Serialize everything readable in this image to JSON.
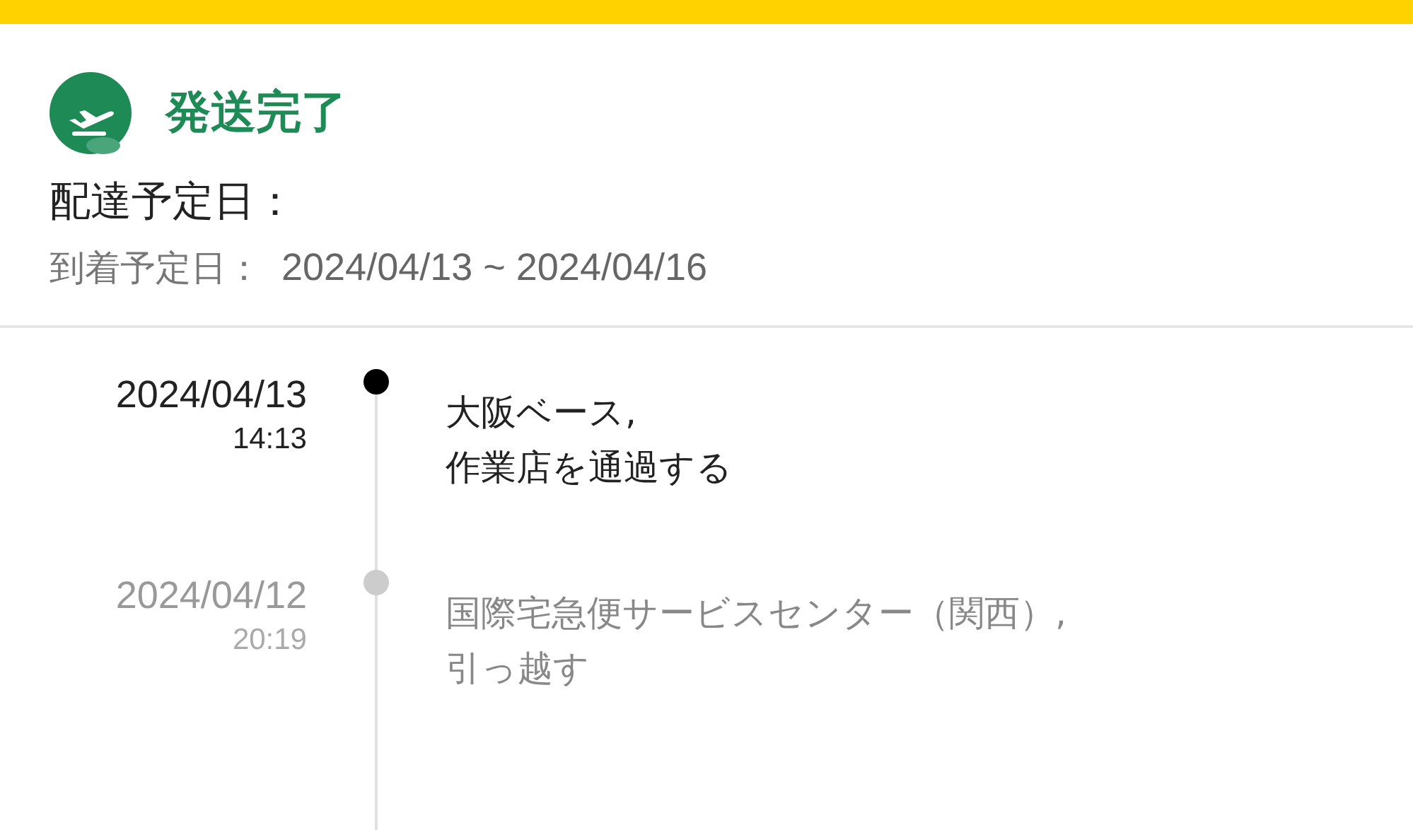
{
  "status": {
    "title": "発送完了"
  },
  "delivery": {
    "label": "配達予定日：",
    "eta_label": "到着予定日：",
    "eta_range": "2024/04/13 ~ 2024/04/16"
  },
  "timeline": [
    {
      "date": "2024/04/13",
      "time": "14:13",
      "place": "大阪ベース,",
      "event": "作業店を通過する",
      "current": true
    },
    {
      "date": "2024/04/12",
      "time": "20:19",
      "place": "国際宅急便サービスセンター（関西）,",
      "event": "引っ越す",
      "current": false
    }
  ]
}
